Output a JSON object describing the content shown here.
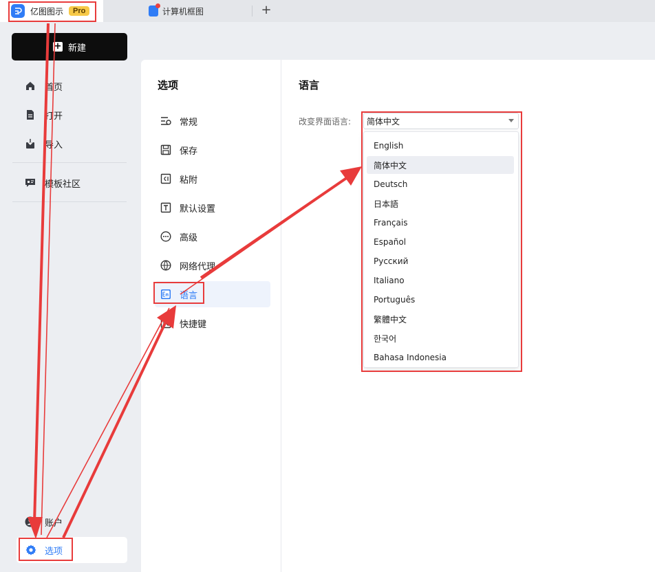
{
  "tabs": {
    "app_name": "亿图图示",
    "pro_badge": "Pro",
    "document_name": "计算机框图",
    "add_tab": "+"
  },
  "sidebar": {
    "new_button": "新建",
    "items": [
      {
        "label": "首页",
        "icon": "home-icon"
      },
      {
        "label": "打开",
        "icon": "document-icon"
      },
      {
        "label": "导入",
        "icon": "import-icon"
      },
      {
        "label": "模板社区",
        "icon": "community-icon"
      }
    ],
    "account_label": "账户",
    "options_label": "选项"
  },
  "options_nav": {
    "title": "选项",
    "items": [
      {
        "label": "常规",
        "icon": "general-settings-icon"
      },
      {
        "label": "保存",
        "icon": "save-icon"
      },
      {
        "label": "粘附",
        "icon": "snap-icon"
      },
      {
        "label": "默认设置",
        "icon": "text-default-icon"
      },
      {
        "label": "高级",
        "icon": "more-icon"
      },
      {
        "label": "网络代理",
        "icon": "globe-icon"
      },
      {
        "label": "语言",
        "icon": "language-icon"
      },
      {
        "label": "快捷键",
        "icon": "shortcut-icon"
      }
    ],
    "active": "语言"
  },
  "language_page": {
    "title": "语言",
    "field_label": "改变界面语言:",
    "selected": "简体中文",
    "options": [
      "English",
      "简体中文",
      "Deutsch",
      "日本語",
      "Français",
      "Español",
      "Русский",
      "Italiano",
      "Português",
      "繁體中文",
      "한국어",
      "Bahasa Indonesia"
    ]
  },
  "colors": {
    "accent": "#2f7cf6",
    "annotation": "#e83b3b",
    "new_button_bg": "#0d0d0d"
  }
}
